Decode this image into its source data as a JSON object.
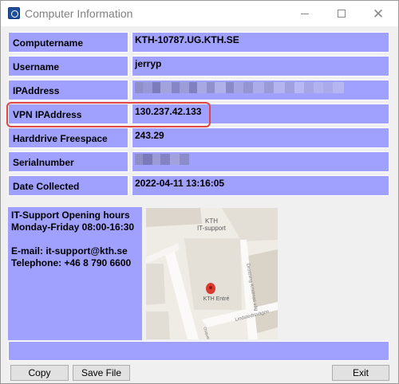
{
  "window": {
    "title": "Computer Information"
  },
  "fields": [
    {
      "label": "Computername",
      "value": "KTH-10787.UG.KTH.SE"
    },
    {
      "label": "Username",
      "value": "jerryp"
    },
    {
      "label": "IPAddress",
      "value": ""
    },
    {
      "label": "VPN IPAddress",
      "value": "130.237.42.133"
    },
    {
      "label": "Harddrive Freespace",
      "value": "243.29"
    },
    {
      "label": "Serialnumber",
      "value": ""
    },
    {
      "label": "Date Collected",
      "value": "2022-04-11 13:16:05"
    }
  ],
  "support": {
    "line1": "IT-Support Opening hours",
    "line2": "Monday-Friday 08:00-16:30",
    "email": "E-mail: it-support@kth.se",
    "phone": "Telephone: +46 8 790 6600"
  },
  "map": {
    "label_top": "KTH",
    "label_top2": "IT-support",
    "label_entrance": "KTH Entré",
    "street_1": "Drottning Kristinas väg",
    "street_2": "Lindstedtsvägen",
    "label_small": "Osquars backe"
  },
  "buttons": {
    "copy": "Copy",
    "save": "Save File",
    "exit": "Exit"
  },
  "colors": {
    "cell_bg": "#a0a0ff",
    "highlight": "#e04545"
  }
}
